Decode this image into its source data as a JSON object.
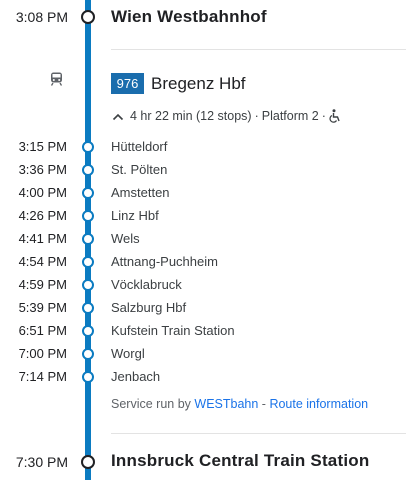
{
  "origin": {
    "time": "3:08 PM",
    "name": "Wien Westbahnhof"
  },
  "leg": {
    "mode_icon": "train-icon",
    "route_number": "976",
    "destination": "Bregenz Hbf",
    "collapse_icon": "chevron-up-icon",
    "duration_text": "4 hr 22 min (12 stops)",
    "separator": "·",
    "platform_text": "Platform 2",
    "accessibility_icon": "wheelchair-icon",
    "stops": [
      {
        "time": "3:15 PM",
        "name": "Hütteldorf"
      },
      {
        "time": "3:36 PM",
        "name": "St. Pölten"
      },
      {
        "time": "4:00 PM",
        "name": "Amstetten"
      },
      {
        "time": "4:26 PM",
        "name": "Linz Hbf"
      },
      {
        "time": "4:41 PM",
        "name": "Wels"
      },
      {
        "time": "4:54 PM",
        "name": "Attnang-Puchheim"
      },
      {
        "time": "4:59 PM",
        "name": "Vöcklabruck"
      },
      {
        "time": "5:39 PM",
        "name": "Salzburg Hbf"
      },
      {
        "time": "6:51 PM",
        "name": "Kufstein Train Station"
      },
      {
        "time": "7:00 PM",
        "name": "Worgl"
      },
      {
        "time": "7:14 PM",
        "name": "Jenbach"
      }
    ],
    "service_prefix": "Service run by",
    "operator": "WESTbahn",
    "service_separator": "-",
    "route_info_link": "Route information"
  },
  "arrival": {
    "time": "7:30 PM",
    "name": "Innsbruck Central Train Station"
  },
  "colors": {
    "line": "#0b7bc1",
    "badge": "#1a6dad",
    "link": "#1a73e8"
  }
}
